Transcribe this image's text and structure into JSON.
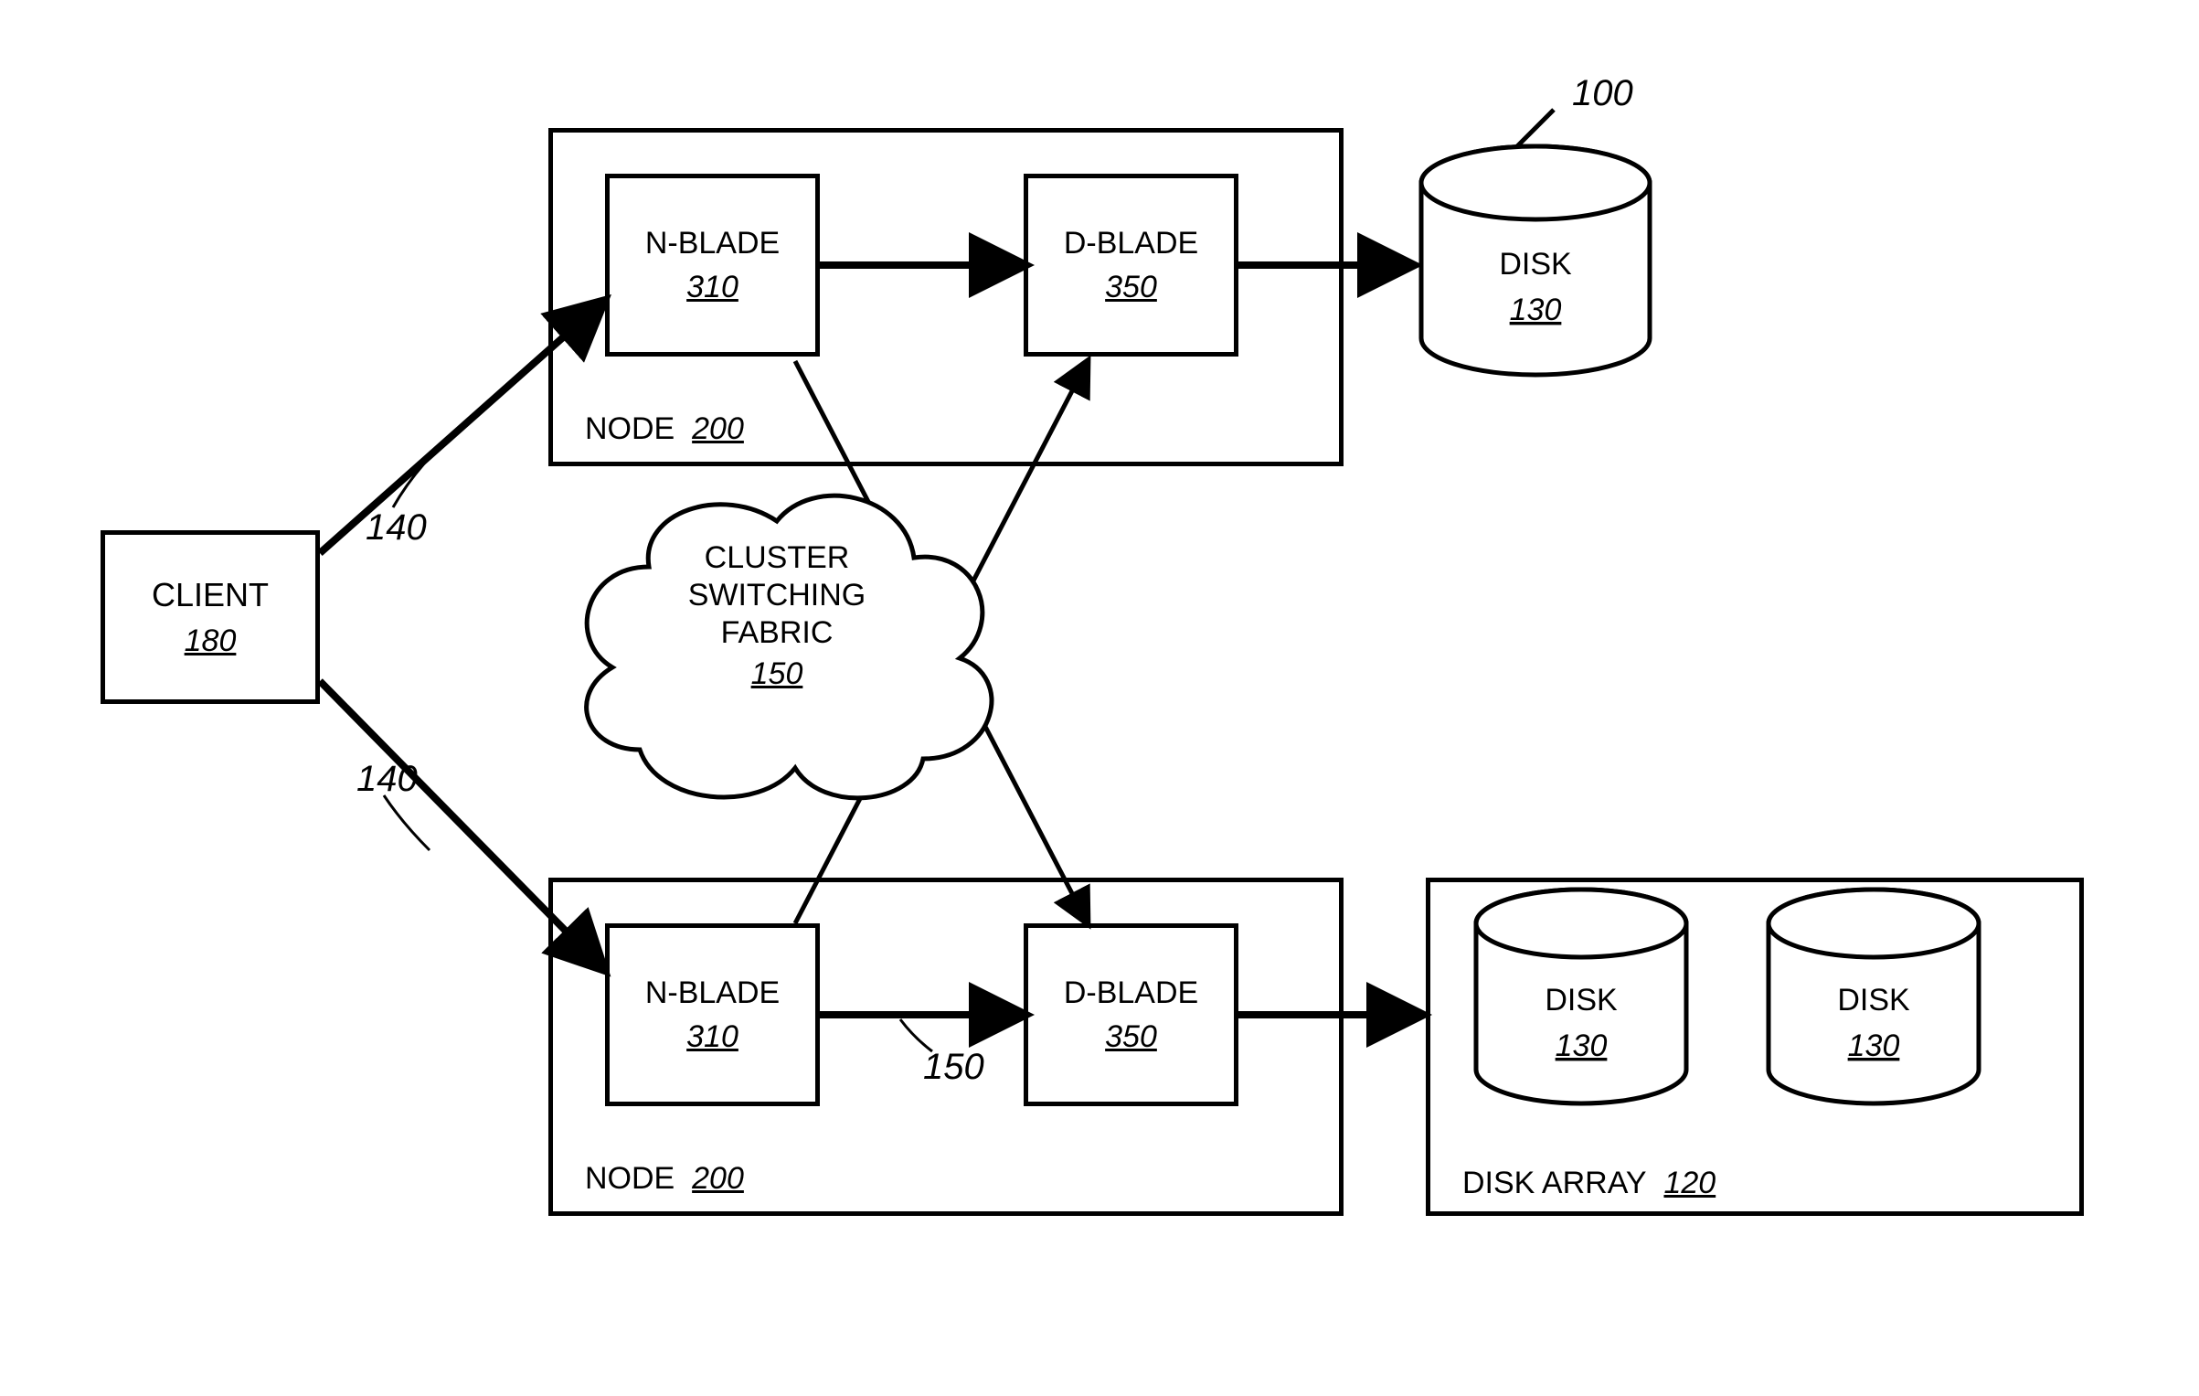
{
  "diagram": {
    "system_ref": "100",
    "client": {
      "label": "CLIENT",
      "ref": "180"
    },
    "link_top_ref": "140",
    "link_bottom_ref": "140",
    "node_top": {
      "caption_prefix": "NODE",
      "caption_ref": "200",
      "nblade": {
        "label": "N-BLADE",
        "ref": "310"
      },
      "dblade": {
        "label": "D-BLADE",
        "ref": "350"
      }
    },
    "node_bottom": {
      "caption_prefix": "NODE",
      "caption_ref": "200",
      "nblade": {
        "label": "N-BLADE",
        "ref": "310"
      },
      "dblade": {
        "label": "D-BLADE",
        "ref": "350"
      },
      "inner_link_ref": "150"
    },
    "fabric": {
      "line1": "CLUSTER",
      "line2": "SWITCHING",
      "line3": "FABRIC",
      "ref": "150"
    },
    "disk_top": {
      "label": "DISK",
      "ref": "130"
    },
    "disk_array": {
      "caption_prefix": "DISK ARRAY",
      "caption_ref": "120",
      "disk1": {
        "label": "DISK",
        "ref": "130"
      },
      "disk2": {
        "label": "DISK",
        "ref": "130"
      }
    }
  }
}
